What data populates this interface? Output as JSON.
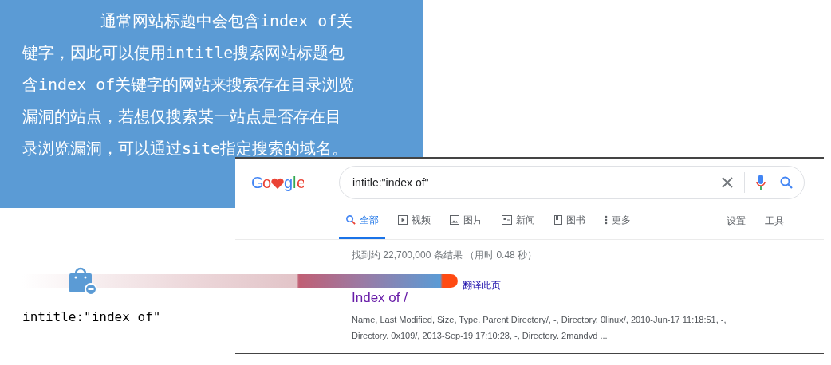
{
  "slide": {
    "paragraph_lines": [
      "通常网站标题中会包含index of关",
      "键字，因此可以使用intitle搜索网站标题包",
      "含index of关键字的网站来搜索存在目录浏览",
      "漏洞的站点，若想仅搜索某一站点是否存在目",
      "录浏览漏洞，可以通过site指定搜索的域名。"
    ],
    "caption": "intitle:\"index of\""
  },
  "search_page": {
    "logo": [
      {
        "text": "G",
        "color": "#4285f4"
      },
      {
        "text": "o",
        "color": "#ea4335"
      },
      {
        "text": "g",
        "color": "#4285f4"
      },
      {
        "text": "l",
        "color": "#34a853"
      },
      {
        "text": "e",
        "color": "#ea4335"
      }
    ],
    "query": "intitle:\"index of\"",
    "tabs": [
      {
        "label": "全部",
        "kind": "search",
        "selected": true
      },
      {
        "label": "视频",
        "kind": "video",
        "selected": false
      },
      {
        "label": "图片",
        "kind": "image",
        "selected": false
      },
      {
        "label": "新闻",
        "kind": "news",
        "selected": false
      },
      {
        "label": "图书",
        "kind": "book",
        "selected": false
      },
      {
        "label": "更多",
        "kind": "more",
        "selected": false
      }
    ],
    "tools": [
      "设置",
      "工具"
    ],
    "result_stats": "找到约 22,700,000 条结果 （用时 0.48 秒）",
    "result": {
      "translate": "翻译此页",
      "title": "Index of /",
      "snippet_lines": [
        "Name, Last Modified, Size, Type. Parent Directory/, -, Directory. 0linux/, 2010-Jun-17 11:18:51, -,",
        "Directory. 0x109/, 2013-Sep-19 17:10:28, -, Directory. 2mandvd ..."
      ]
    }
  }
}
